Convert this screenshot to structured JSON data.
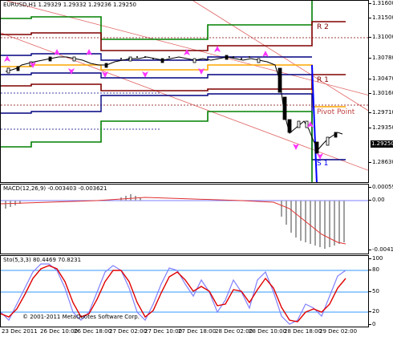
{
  "main": {
    "title": "EURUSD,H1  1.29329 1.29332 1.29236 1.29250",
    "price_badge": "1.29250",
    "axis_labels": [
      "1.31600",
      "1.31500",
      "1.31000",
      "1.30780",
      "1.30470",
      "1.30160",
      "1.29710",
      "1.29350",
      "1.29250",
      "1.28630"
    ],
    "levels": {
      "r2": "R 2",
      "r1": "R 1",
      "pivot": "Pivot Point",
      "s1": "S 1"
    },
    "colors": {
      "r2": "#800000",
      "r1": "#800000",
      "pivot": "#c04040",
      "s1": "#0000ff",
      "green": "#008000",
      "orange": "#ffa500",
      "navy": "#000080"
    }
  },
  "macd": {
    "title": "MACD(12,26,9) -0.003403 -0.003621",
    "axis_labels": [
      "0.000591",
      "0.00",
      "-0.00411"
    ]
  },
  "stoch": {
    "title": "Sto(5,3,3) 80.4469 70.8231",
    "axis_labels": [
      "100",
      "80",
      "50",
      "20",
      "0"
    ]
  },
  "copyright": "© 2001-2011 MetaQuotes Software Corp.",
  "time_labels": [
    "23 Dec 2011",
    "26 Dec 10:00",
    "26 Dec 18:00",
    "27 Dec 02:00",
    "27 Dec 10:00",
    "27 Dec 18:00",
    "28 Dec 02:00",
    "28 Dec 10:00",
    "28 Dec 18:00",
    "29 Dec 02:00"
  ]
}
